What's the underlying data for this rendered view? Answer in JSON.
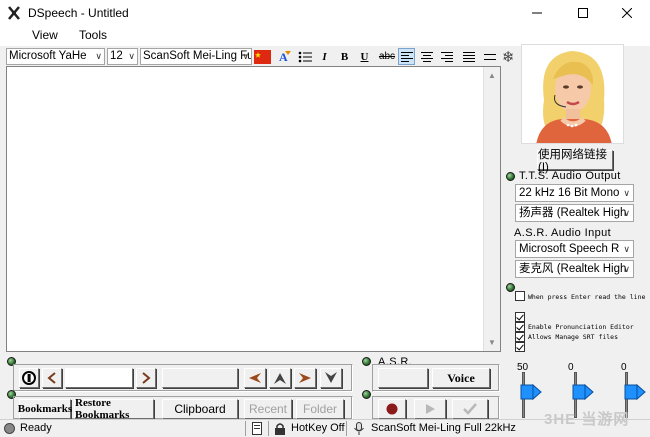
{
  "window": {
    "title": "DSpeech - Untitled"
  },
  "menu": {
    "view": "View",
    "tools": "Tools"
  },
  "toolbar": {
    "font": "Microsoft YaHe",
    "size": "12",
    "voice": "ScanSoft Mei-Ling Fu",
    "italic": "I",
    "bold": "B",
    "underline": "U",
    "strike": "abc"
  },
  "tts": {
    "label": "T.T.S. Audio Output",
    "format": "22 kHz 16 Bit Mono",
    "device": "扬声器 (Realtek High"
  },
  "asr_input": {
    "label": "A.S.R. Audio Input",
    "engine": "Microsoft Speech R",
    "device": "麦克风 (Realtek High"
  },
  "web_button": "使用网络链接(I)",
  "options": {
    "enter_read": "When press Enter read the line",
    "pronunciation": "Enable Pronunciation Editor",
    "srt": "Allows Manage SRT files"
  },
  "bottom": {
    "bookmarks": "Bookmarks",
    "restore": "Restore Bookmarks",
    "clipboard": "Clipboard",
    "recent": "Recent",
    "folder": "Folder",
    "asr_label": "A.S.R.",
    "voice_btn": "Voice"
  },
  "sliders": {
    "s1": "50",
    "s2": "0",
    "s3": "0"
  },
  "status": {
    "ready": "Ready",
    "hotkey": "HotKey Off",
    "voice": "ScanSoft Mei-Ling Full 22kHz"
  },
  "watermark": "3HE 当游网",
  "colors": {
    "flag": "#de2910",
    "badge": "#2a6f2a",
    "slider_thumb": "#1e90ff"
  }
}
